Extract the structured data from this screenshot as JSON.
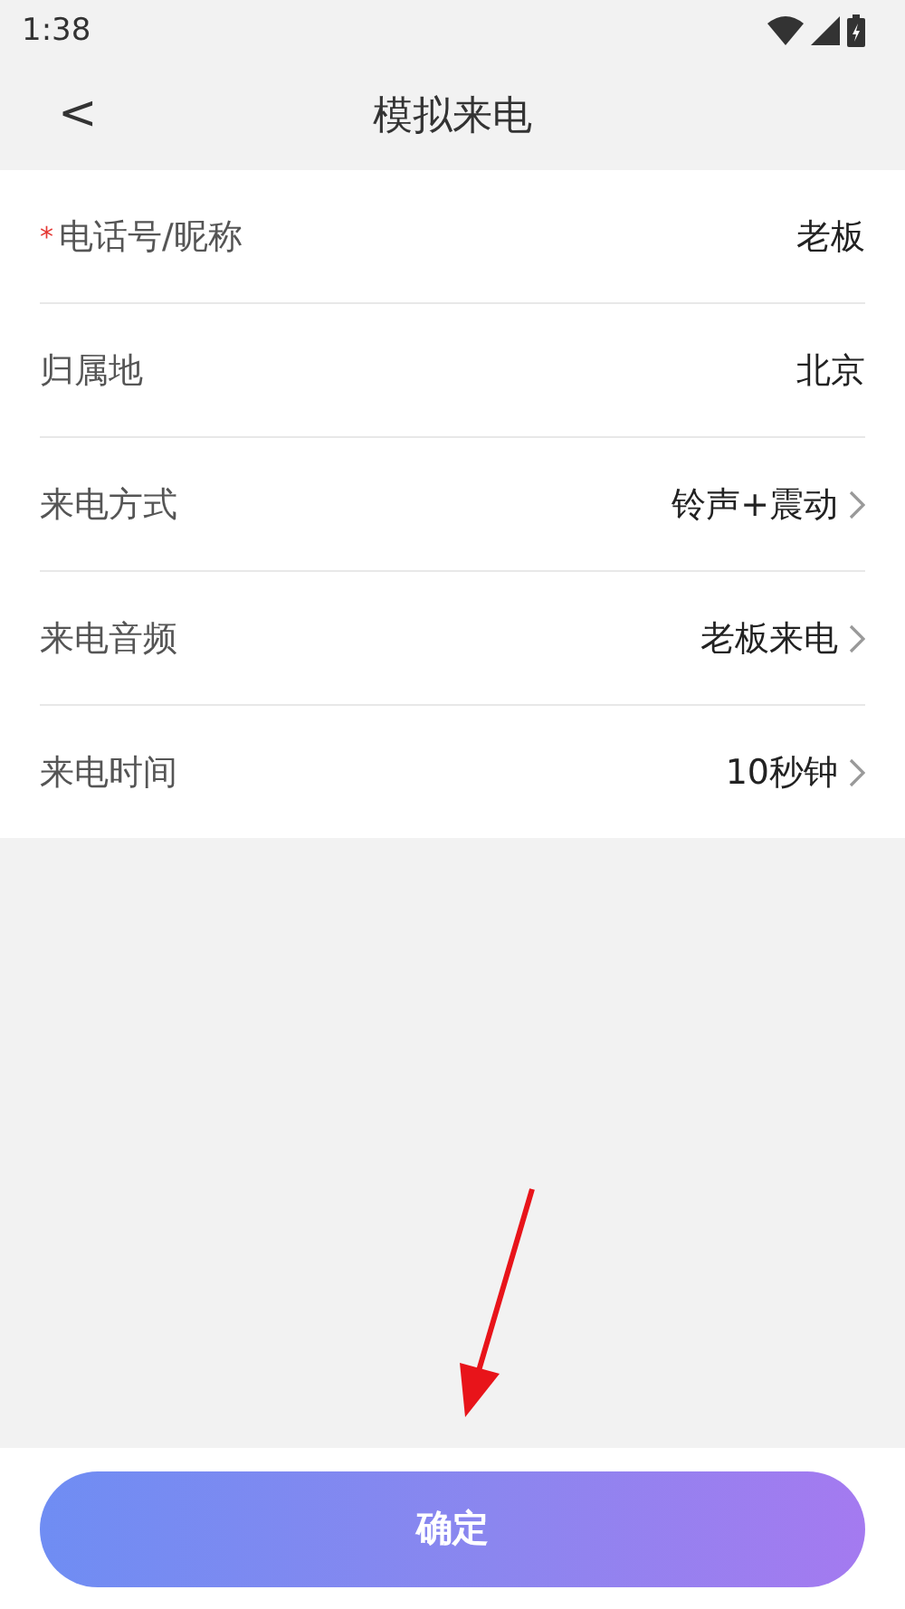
{
  "status_bar": {
    "time": "1:38"
  },
  "header": {
    "back": "<",
    "title": "模拟来电"
  },
  "rows": [
    {
      "label": "电话号/昵称",
      "required_mark": "*",
      "value": "老板",
      "chevron": false
    },
    {
      "label": "归属地",
      "value": "北京",
      "chevron": false
    },
    {
      "label": "来电方式",
      "value": "铃声+震动",
      "chevron": true
    },
    {
      "label": "来电音频",
      "value": "老板来电",
      "chevron": true
    },
    {
      "label": "来电时间",
      "value": "10秒钟",
      "chevron": true
    }
  ],
  "confirm_button": "确定"
}
